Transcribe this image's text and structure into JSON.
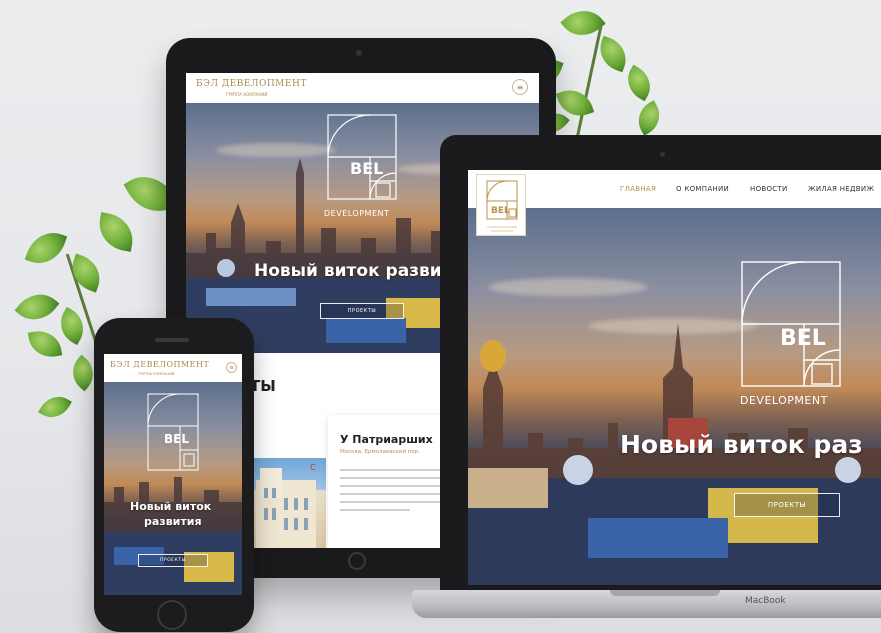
{
  "site": {
    "brand_ru": "БЭЛ ДЕВЕЛОПМЕНТ",
    "brand_sub": "ГРУППА КОМПАНИЙ",
    "logo_word": "BEL",
    "logo_sub": "DEVELOPMENT",
    "hero_title": "Новый виток развития",
    "hero_title_phone_line1": "Новый виток",
    "hero_title_phone_line2": "развития",
    "hero_button": "ПРОЕКТЫ",
    "laptop_brand": "MacBook",
    "colors": {
      "gold": "#b8924a",
      "dark": "#1b1b1d"
    }
  },
  "laptop": {
    "nav": [
      {
        "label": "ГЛАВНАЯ",
        "active": true
      },
      {
        "label": "О КОМПАНИИ",
        "active": false
      },
      {
        "label": "НОВОСТИ",
        "active": false
      },
      {
        "label": "ЖИЛАЯ НЕДВИЖ",
        "active": false
      }
    ],
    "hero_title_visible": "Новый виток раз"
  },
  "tablet": {
    "hero_title_visible": "Новый виток разви",
    "projects_heading": "ТЫ",
    "card": {
      "title": "У Патриарших",
      "address": "Москва, Ермолаевский пер."
    }
  }
}
